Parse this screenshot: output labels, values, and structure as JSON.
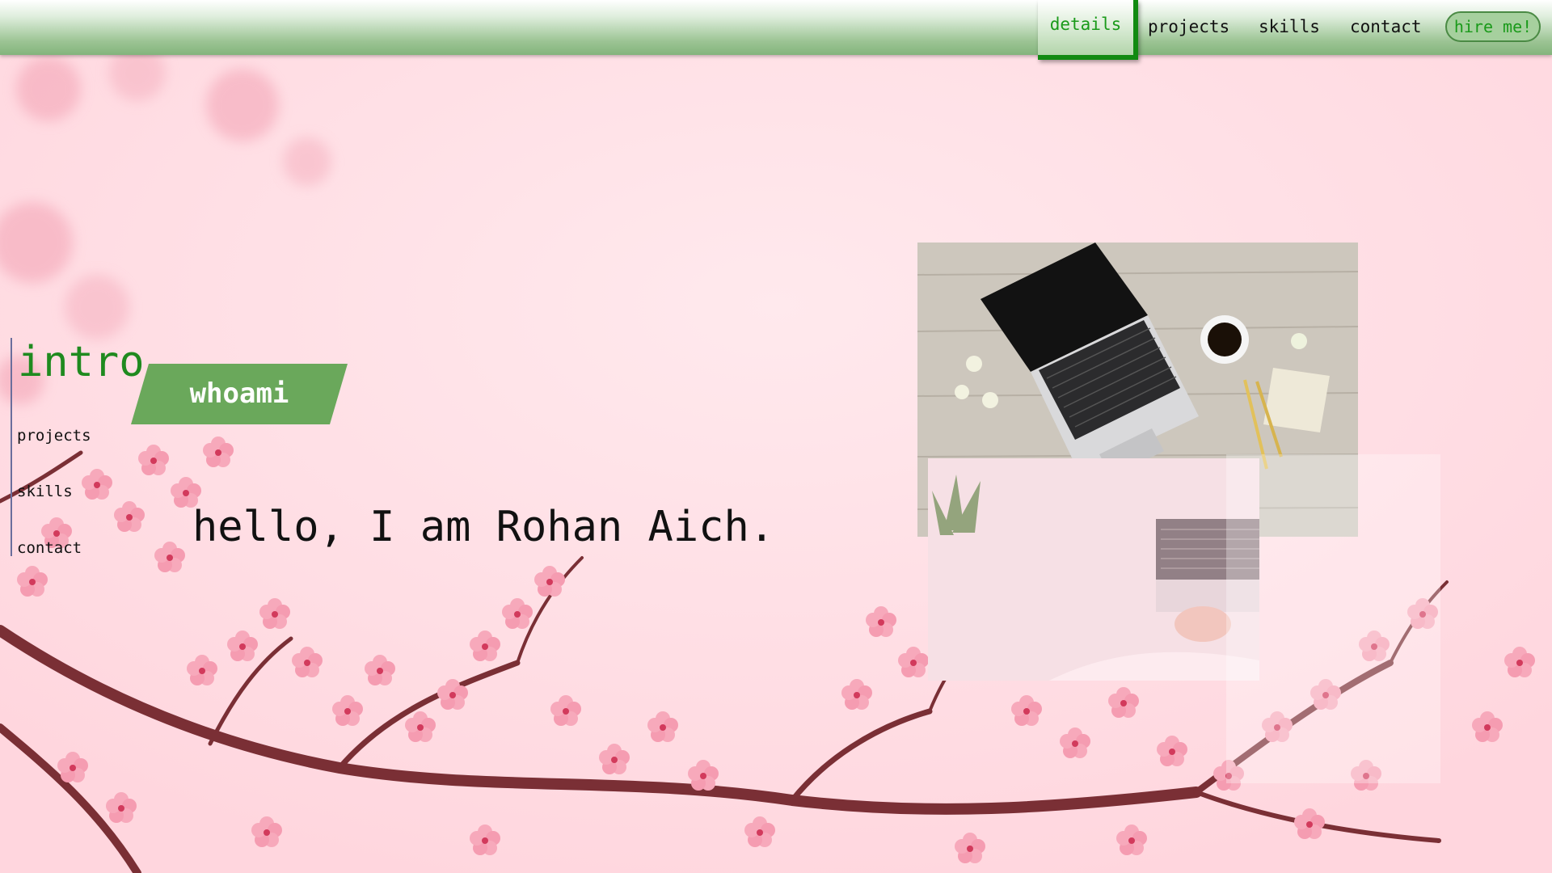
{
  "topnav": {
    "items": [
      "details",
      "projects",
      "skills",
      "contact"
    ],
    "active": "details",
    "hire_label": "hire me!"
  },
  "sidenav": {
    "current": "intro",
    "items": [
      "projects",
      "skills",
      "contact"
    ]
  },
  "hero": {
    "tag": "whoami",
    "greeting": "hello, I am Rohan Aich."
  },
  "colors": {
    "accent_green": "#1a9a1a",
    "banner_green": "#6aa85b",
    "background_pink": "#ffdde3",
    "blossom_pink": "#f49ab0"
  },
  "icons": {
    "background": "cherry-blossom-branch-image",
    "photo_main": "laptop-coffee-desk-photo",
    "photo_secondary": "hands-on-laptop-photo"
  }
}
